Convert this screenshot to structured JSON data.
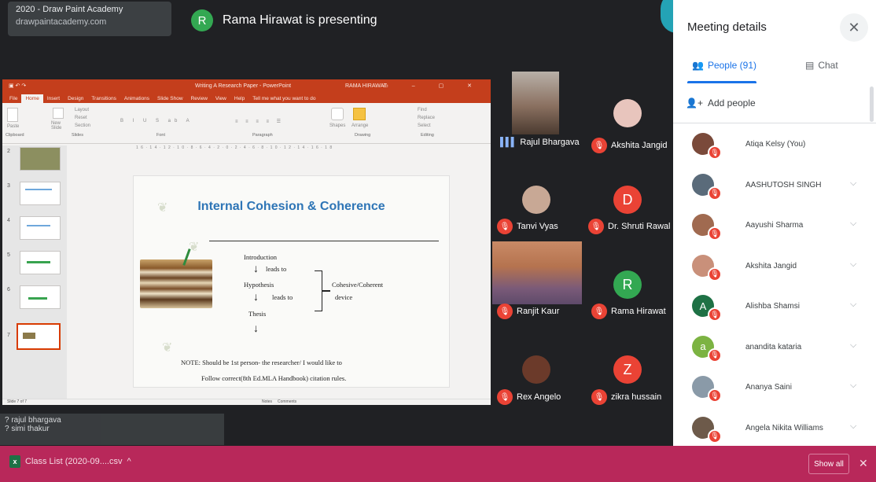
{
  "watermark": {
    "line1": "2020 - Draw Paint Academy",
    "line2": "drawpaintacademy.com"
  },
  "presenter": {
    "avatar_letter": "R",
    "banner_text": "Rama Hirawat is presenting"
  },
  "ppt": {
    "window_title": "Writing A Research Paper - PowerPoint",
    "user": "RAMA HIRAWAT",
    "tabs": [
      "File",
      "Home",
      "Insert",
      "Design",
      "Transitions",
      "Animations",
      "Slide Show",
      "Review",
      "View",
      "Help",
      "Tell me what you want to do"
    ],
    "ribbon": {
      "paste": "Paste",
      "clipboard": "Clipboard",
      "new_slide": "New Slide",
      "layout": "Layout",
      "reset": "Reset",
      "section": "Section",
      "slides": "Slides",
      "font": "Font",
      "paragraph": "Paragraph",
      "shapes": "Shapes",
      "arrange": "Arrange",
      "drawing": "Drawing",
      "find": "Find",
      "replace": "Replace",
      "select": "Select",
      "editing": "Editing"
    },
    "slide_numbers": [
      "2",
      "3",
      "4",
      "5",
      "6",
      "7"
    ],
    "slide": {
      "title": "Internal Cohesion & Coherence",
      "introduction": "Introduction",
      "leads_to_1": "leads to",
      "hypothesis": "Hypothesis",
      "leads_to_2": "leads to",
      "thesis": "Thesis",
      "cohesive": "Cohesive/Coherent",
      "device": "device",
      "note_line1": "NOTE: Should be 1st person- the researcher/ I would like to",
      "note_line2": "Follow correct(8th Ed.MLA Handbook) citation rules."
    },
    "status": {
      "slide": "Slide 7 of 7",
      "notes": "Notes",
      "comments": "Comments"
    }
  },
  "participants": [
    {
      "name": "Rajul Bhargava",
      "state": "speaking"
    },
    {
      "name": "Akshita Jangid",
      "state": "muted"
    },
    {
      "name": "Tanvi Vyas",
      "state": "muted"
    },
    {
      "name": "Dr. Shruti Rawal",
      "state": "muted",
      "letter": "D",
      "color": "#ea4335"
    },
    {
      "name": "Ranjit Kaur",
      "state": "muted"
    },
    {
      "name": "Rama Hirawat",
      "state": "muted",
      "letter": "R",
      "color": "#33a852"
    },
    {
      "name": "Rex Angelo",
      "state": "muted"
    },
    {
      "name": "zikra hussain",
      "state": "muted",
      "letter": "Z",
      "color": "#ea4335"
    }
  ],
  "chat_overlay": {
    "line1": "? rajul bhargava",
    "line2": "? simi thakur"
  },
  "panel": {
    "title": "Meeting details",
    "tab_people": "People (91)",
    "tab_chat": "Chat",
    "add_people": "Add people",
    "people": [
      {
        "name": "Atiqa Kelsy (You)",
        "color": "#7a4a3a",
        "letter": ""
      },
      {
        "name": "AASHUTOSH SINGH",
        "color": "#5a6b7a",
        "letter": ""
      },
      {
        "name": "Aayushi Sharma",
        "color": "#a06a50",
        "letter": ""
      },
      {
        "name": "Akshita Jangid",
        "color": "#c9907a",
        "letter": ""
      },
      {
        "name": "Alishba Shamsi",
        "color": "#1e7145",
        "letter": "A"
      },
      {
        "name": "anandita kataria",
        "color": "#7cb342",
        "letter": "a"
      },
      {
        "name": "Ananya Saini",
        "color": "#8a9aa8",
        "letter": ""
      },
      {
        "name": "Angela Nikita Williams",
        "color": "#6d5a4a",
        "letter": ""
      }
    ]
  },
  "downloads": {
    "filename": "Class List (2020-09....csv",
    "show_all": "Show all"
  },
  "colors": {
    "meet_bg": "#202124",
    "ppt_red": "#c43e1c",
    "mic_red": "#ea4335",
    "blue": "#1a73e8",
    "download_bar": "#b8285a"
  }
}
